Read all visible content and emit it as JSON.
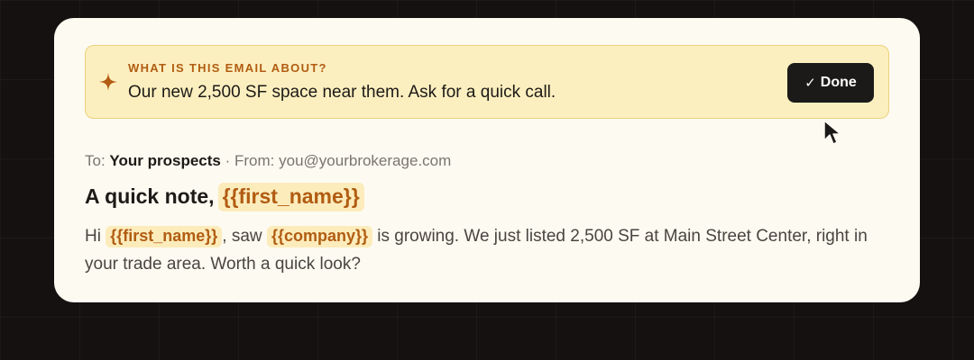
{
  "prompt": {
    "icon": "sparkle-icon",
    "label": "WHAT IS THIS EMAIL ABOUT?",
    "text": "Our new 2,500 SF space near them. Ask for a quick call.",
    "done_check": "✓",
    "done_label": "Done",
    "accent_color": "#b15c12",
    "background_color": "#fcefbf"
  },
  "email": {
    "to_label": "To:",
    "to_value": "Your prospects",
    "separator": "·",
    "from_label": "From:",
    "from_value": "you@yourbrokerage.com",
    "subject_text": "A quick note,",
    "subject_var": "{{first_name}}",
    "body": {
      "hi": "Hi",
      "var_first_name": "{{first_name}}",
      "saw": ", saw",
      "var_company": "{{company}}",
      "rest": "is growing. We just listed 2,500 SF at Main Street Center, right in your trade area. Worth a quick look?"
    }
  },
  "cursor": {
    "icon": "mouse-pointer-icon"
  }
}
